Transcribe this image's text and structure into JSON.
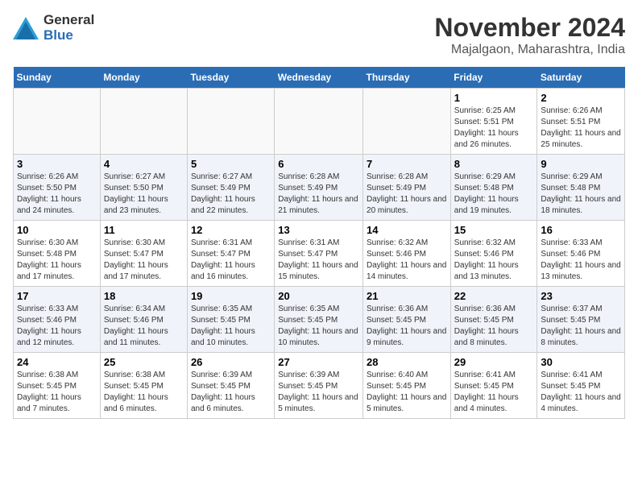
{
  "header": {
    "logo_general": "General",
    "logo_blue": "Blue",
    "month": "November 2024",
    "location": "Majalgaon, Maharashtra, India"
  },
  "days_of_week": [
    "Sunday",
    "Monday",
    "Tuesday",
    "Wednesday",
    "Thursday",
    "Friday",
    "Saturday"
  ],
  "weeks": [
    [
      {
        "day": "",
        "info": ""
      },
      {
        "day": "",
        "info": ""
      },
      {
        "day": "",
        "info": ""
      },
      {
        "day": "",
        "info": ""
      },
      {
        "day": "",
        "info": ""
      },
      {
        "day": "1",
        "info": "Sunrise: 6:25 AM\nSunset: 5:51 PM\nDaylight: 11 hours and 26 minutes."
      },
      {
        "day": "2",
        "info": "Sunrise: 6:26 AM\nSunset: 5:51 PM\nDaylight: 11 hours and 25 minutes."
      }
    ],
    [
      {
        "day": "3",
        "info": "Sunrise: 6:26 AM\nSunset: 5:50 PM\nDaylight: 11 hours and 24 minutes."
      },
      {
        "day": "4",
        "info": "Sunrise: 6:27 AM\nSunset: 5:50 PM\nDaylight: 11 hours and 23 minutes."
      },
      {
        "day": "5",
        "info": "Sunrise: 6:27 AM\nSunset: 5:49 PM\nDaylight: 11 hours and 22 minutes."
      },
      {
        "day": "6",
        "info": "Sunrise: 6:28 AM\nSunset: 5:49 PM\nDaylight: 11 hours and 21 minutes."
      },
      {
        "day": "7",
        "info": "Sunrise: 6:28 AM\nSunset: 5:49 PM\nDaylight: 11 hours and 20 minutes."
      },
      {
        "day": "8",
        "info": "Sunrise: 6:29 AM\nSunset: 5:48 PM\nDaylight: 11 hours and 19 minutes."
      },
      {
        "day": "9",
        "info": "Sunrise: 6:29 AM\nSunset: 5:48 PM\nDaylight: 11 hours and 18 minutes."
      }
    ],
    [
      {
        "day": "10",
        "info": "Sunrise: 6:30 AM\nSunset: 5:48 PM\nDaylight: 11 hours and 17 minutes."
      },
      {
        "day": "11",
        "info": "Sunrise: 6:30 AM\nSunset: 5:47 PM\nDaylight: 11 hours and 17 minutes."
      },
      {
        "day": "12",
        "info": "Sunrise: 6:31 AM\nSunset: 5:47 PM\nDaylight: 11 hours and 16 minutes."
      },
      {
        "day": "13",
        "info": "Sunrise: 6:31 AM\nSunset: 5:47 PM\nDaylight: 11 hours and 15 minutes."
      },
      {
        "day": "14",
        "info": "Sunrise: 6:32 AM\nSunset: 5:46 PM\nDaylight: 11 hours and 14 minutes."
      },
      {
        "day": "15",
        "info": "Sunrise: 6:32 AM\nSunset: 5:46 PM\nDaylight: 11 hours and 13 minutes."
      },
      {
        "day": "16",
        "info": "Sunrise: 6:33 AM\nSunset: 5:46 PM\nDaylight: 11 hours and 13 minutes."
      }
    ],
    [
      {
        "day": "17",
        "info": "Sunrise: 6:33 AM\nSunset: 5:46 PM\nDaylight: 11 hours and 12 minutes."
      },
      {
        "day": "18",
        "info": "Sunrise: 6:34 AM\nSunset: 5:46 PM\nDaylight: 11 hours and 11 minutes."
      },
      {
        "day": "19",
        "info": "Sunrise: 6:35 AM\nSunset: 5:45 PM\nDaylight: 11 hours and 10 minutes."
      },
      {
        "day": "20",
        "info": "Sunrise: 6:35 AM\nSunset: 5:45 PM\nDaylight: 11 hours and 10 minutes."
      },
      {
        "day": "21",
        "info": "Sunrise: 6:36 AM\nSunset: 5:45 PM\nDaylight: 11 hours and 9 minutes."
      },
      {
        "day": "22",
        "info": "Sunrise: 6:36 AM\nSunset: 5:45 PM\nDaylight: 11 hours and 8 minutes."
      },
      {
        "day": "23",
        "info": "Sunrise: 6:37 AM\nSunset: 5:45 PM\nDaylight: 11 hours and 8 minutes."
      }
    ],
    [
      {
        "day": "24",
        "info": "Sunrise: 6:38 AM\nSunset: 5:45 PM\nDaylight: 11 hours and 7 minutes."
      },
      {
        "day": "25",
        "info": "Sunrise: 6:38 AM\nSunset: 5:45 PM\nDaylight: 11 hours and 6 minutes."
      },
      {
        "day": "26",
        "info": "Sunrise: 6:39 AM\nSunset: 5:45 PM\nDaylight: 11 hours and 6 minutes."
      },
      {
        "day": "27",
        "info": "Sunrise: 6:39 AM\nSunset: 5:45 PM\nDaylight: 11 hours and 5 minutes."
      },
      {
        "day": "28",
        "info": "Sunrise: 6:40 AM\nSunset: 5:45 PM\nDaylight: 11 hours and 5 minutes."
      },
      {
        "day": "29",
        "info": "Sunrise: 6:41 AM\nSunset: 5:45 PM\nDaylight: 11 hours and 4 minutes."
      },
      {
        "day": "30",
        "info": "Sunrise: 6:41 AM\nSunset: 5:45 PM\nDaylight: 11 hours and 4 minutes."
      }
    ]
  ]
}
